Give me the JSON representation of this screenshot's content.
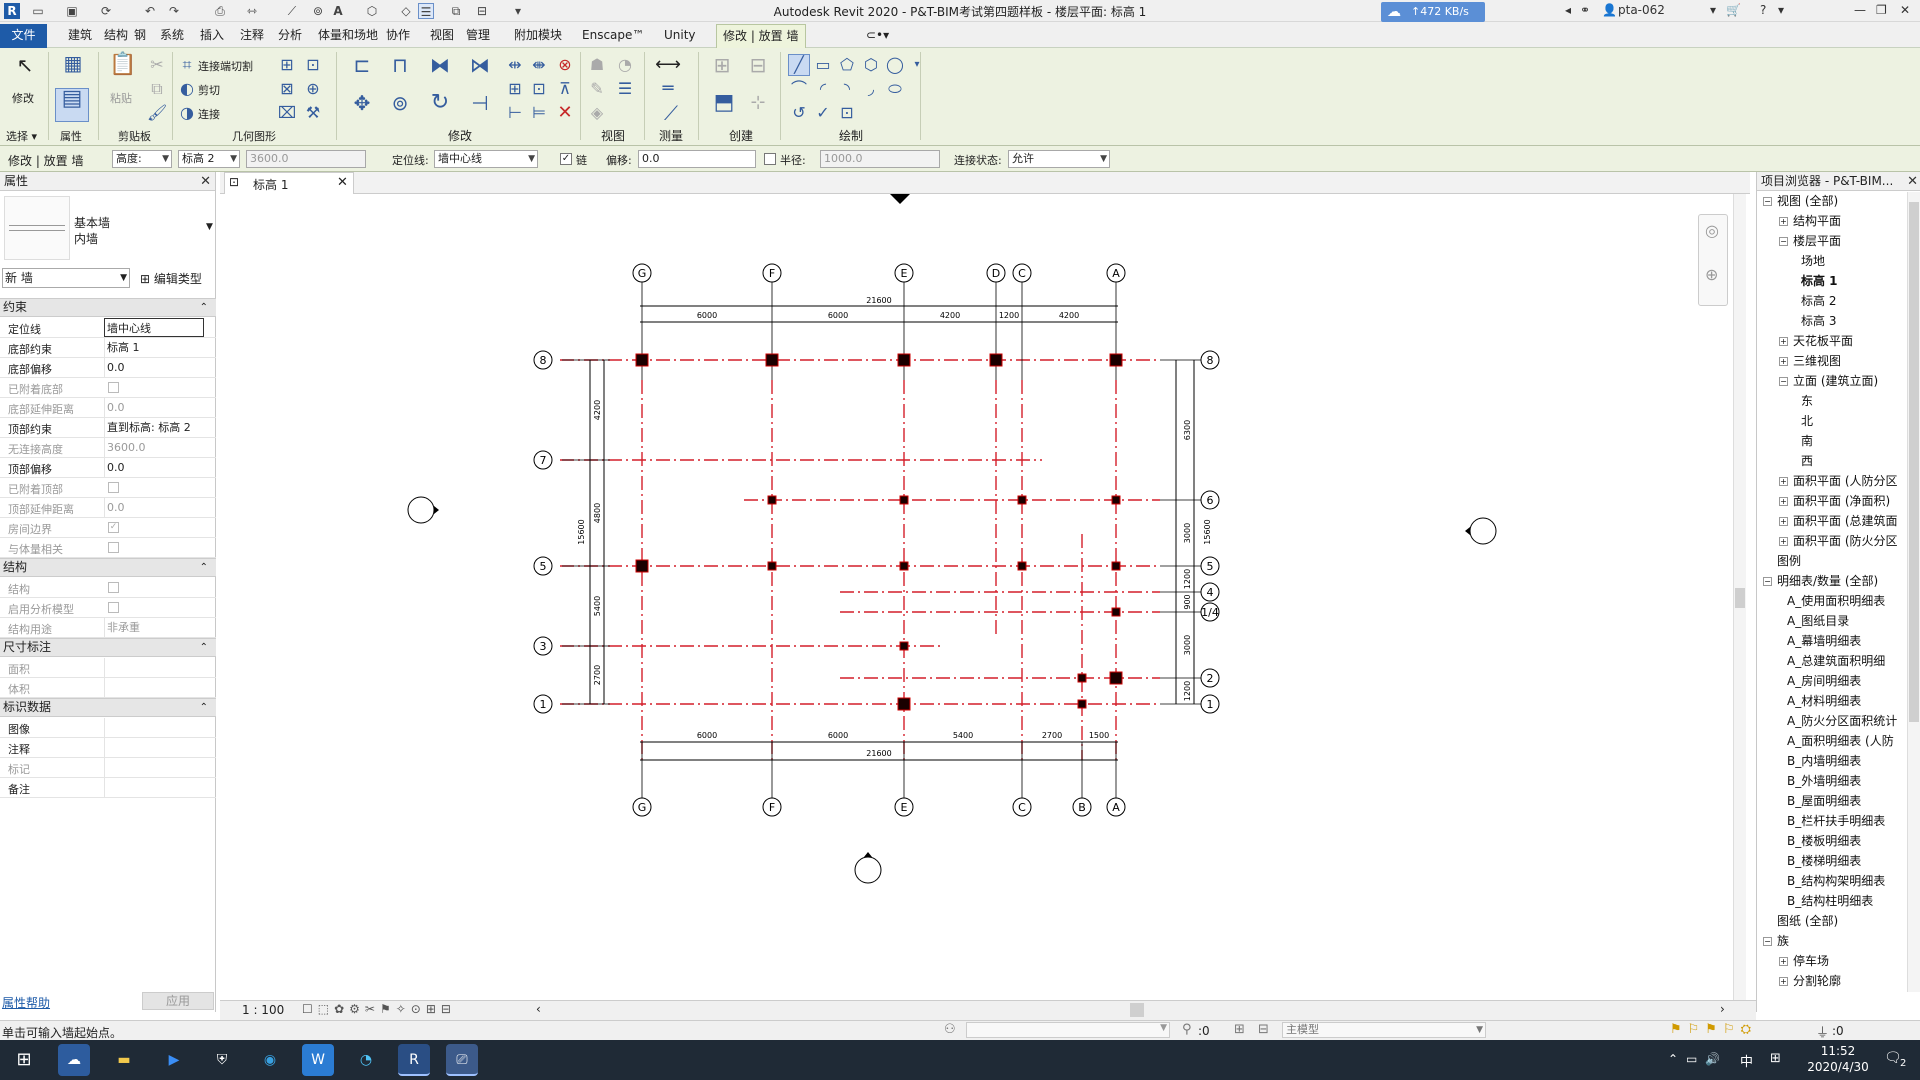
{
  "window": {
    "title": "Autodesk Revit 2020 - P&T-BIM考试第四题样板 - 楼层平面: 标高 1",
    "user": "pta-062",
    "upload_speed": "↑472 KB/s"
  },
  "ribbon_tabs": [
    "文件",
    "建筑",
    "结构",
    "钢",
    "系统",
    "插入",
    "注释",
    "分析",
    "体量和场地",
    "协作",
    "视图",
    "管理",
    "附加模块",
    "Enscape™",
    "Unity",
    "修改 | 放置 墙"
  ],
  "active_tab": "修改 | 放置 墙",
  "ribbon": {
    "select": {
      "modify": "修改",
      "label": "选择 ▾"
    },
    "properties_label": "属性",
    "clipboard": {
      "paste": "粘贴",
      "label": "剪贴板"
    },
    "geometry": {
      "join_cut": "连接端切割",
      "cut": "剪切",
      "join": "连接",
      "label": "几何图形"
    },
    "panels": {
      "modify": "修改",
      "view": "视图",
      "measure": "测量",
      "create": "创建",
      "draw": "绘制"
    }
  },
  "options_bar": {
    "context": "修改 | 放置 墙",
    "height_mode": "高度:",
    "level": "标高 2",
    "height_value": "3600.0",
    "location_line_label": "定位线:",
    "location_line": "墙中心线",
    "chain_label": "链",
    "offset_label": "偏移:",
    "offset_value": "0.0",
    "radius_label": "半径:",
    "radius_value": "1000.0",
    "join_status_label": "连接状态:",
    "join_status": "允许"
  },
  "properties": {
    "title": "属性",
    "type_family": "基本墙",
    "type_name": "内墙",
    "instance_filter": "新 墙",
    "edit_type": "编辑类型",
    "groups": [
      {
        "name": "约束",
        "rows": [
          {
            "k": "定位线",
            "v": "墙中心线",
            "box": true
          },
          {
            "k": "底部约束",
            "v": "标高 1"
          },
          {
            "k": "底部偏移",
            "v": "0.0"
          },
          {
            "k": "已附着底部",
            "cb": true,
            "dis": true
          },
          {
            "k": "底部延伸距离",
            "v": "0.0",
            "dis": true
          },
          {
            "k": "顶部约束",
            "v": "直到标高: 标高 2"
          },
          {
            "k": "无连接高度",
            "v": "3600.0",
            "dis": true
          },
          {
            "k": "顶部偏移",
            "v": "0.0"
          },
          {
            "k": "已附着顶部",
            "cb": true,
            "dis": true
          },
          {
            "k": "顶部延伸距离",
            "v": "0.0",
            "dis": true
          },
          {
            "k": "房间边界",
            "cb": true,
            "checked": true,
            "dis": true
          },
          {
            "k": "与体量相关",
            "cb": true,
            "dis": true
          }
        ]
      },
      {
        "name": "结构",
        "rows": [
          {
            "k": "结构",
            "cb": true,
            "dis": true
          },
          {
            "k": "启用分析模型",
            "cb": true,
            "dis": true
          },
          {
            "k": "结构用途",
            "v": "非承重",
            "dis": true
          }
        ]
      },
      {
        "name": "尺寸标注",
        "rows": [
          {
            "k": "面积",
            "v": "",
            "dis": true
          },
          {
            "k": "体积",
            "v": "",
            "dis": true
          }
        ]
      },
      {
        "name": "标识数据",
        "rows": [
          {
            "k": "图像",
            "v": ""
          },
          {
            "k": "注释",
            "v": ""
          },
          {
            "k": "标记",
            "v": "",
            "dis": true
          },
          {
            "k": "备注",
            "v": ""
          }
        ]
      }
    ],
    "help": "属性帮助",
    "apply": "应用"
  },
  "view_tab": "标高 1",
  "plan": {
    "top_axes": [
      "G",
      "F",
      "E",
      "D",
      "C",
      "A"
    ],
    "bottom_axes": [
      "G",
      "F",
      "E",
      "C",
      "B",
      "A"
    ],
    "left_axes": [
      "8",
      "7",
      "5",
      "3",
      "1"
    ],
    "right_axes": [
      "8",
      "6",
      "5",
      "4",
      "1/4",
      "2",
      "1"
    ],
    "top_dims": [
      "6000",
      "6000",
      "4200",
      "1200",
      "4200"
    ],
    "top_total": "21600",
    "bottom_dims": [
      "6000",
      "6000",
      "5400",
      "2700",
      "1500"
    ],
    "bottom_total": "21600",
    "left_dims": [
      "4200",
      "4800",
      "5400",
      "2700"
    ],
    "left_total": "15600",
    "right_dims": [
      "6300",
      "3000",
      "1200",
      "900",
      "3000",
      "1200"
    ],
    "right_total": "15600"
  },
  "browser": {
    "title": "项目浏览器 - P&T-BIM...",
    "items": [
      {
        "t": "视图 (全部)",
        "lv": 0,
        "ex": "−"
      },
      {
        "t": "结构平面",
        "lv": 1,
        "ex": "+"
      },
      {
        "t": "楼层平面",
        "lv": 1,
        "ex": "−"
      },
      {
        "t": "场地",
        "lv": 2
      },
      {
        "t": "标高 1",
        "lv": 2,
        "bold": true
      },
      {
        "t": "标高 2",
        "lv": 2
      },
      {
        "t": "标高 3",
        "lv": 2
      },
      {
        "t": "天花板平面",
        "lv": 1,
        "ex": "+"
      },
      {
        "t": "三维视图",
        "lv": 1,
        "ex": "+"
      },
      {
        "t": "立面 (建筑立面)",
        "lv": 1,
        "ex": "−"
      },
      {
        "t": "东",
        "lv": 2
      },
      {
        "t": "北",
        "lv": 2
      },
      {
        "t": "南",
        "lv": 2
      },
      {
        "t": "西",
        "lv": 2
      },
      {
        "t": "面积平面 (人防分区",
        "lv": 1,
        "ex": "+"
      },
      {
        "t": "面积平面 (净面积)",
        "lv": 1,
        "ex": "+"
      },
      {
        "t": "面积平面 (总建筑面",
        "lv": 1,
        "ex": "+"
      },
      {
        "t": "面积平面 (防火分区",
        "lv": 1,
        "ex": "+"
      },
      {
        "t": "图例",
        "lv": 0
      },
      {
        "t": "明细表/数量 (全部)",
        "lv": 0,
        "ex": "−"
      },
      {
        "t": "A_使用面积明细表",
        "lv": 1
      },
      {
        "t": "A_图纸目录",
        "lv": 1
      },
      {
        "t": "A_幕墙明细表",
        "lv": 1
      },
      {
        "t": "A_总建筑面积明细",
        "lv": 1
      },
      {
        "t": "A_房间明细表",
        "lv": 1
      },
      {
        "t": "A_材料明细表",
        "lv": 1
      },
      {
        "t": "A_防火分区面积统计",
        "lv": 1
      },
      {
        "t": "A_面积明细表 (人防",
        "lv": 1
      },
      {
        "t": "B_内墙明细表",
        "lv": 1
      },
      {
        "t": "B_外墙明细表",
        "lv": 1
      },
      {
        "t": "B_屋面明细表",
        "lv": 1
      },
      {
        "t": "B_栏杆扶手明细表",
        "lv": 1
      },
      {
        "t": "B_楼板明细表",
        "lv": 1
      },
      {
        "t": "B_楼梯明细表",
        "lv": 1
      },
      {
        "t": "B_结构构架明细表",
        "lv": 1
      },
      {
        "t": "B_结构柱明细表",
        "lv": 1
      },
      {
        "t": "图纸 (全部)",
        "lv": 0
      },
      {
        "t": "族",
        "lv": 0,
        "ex": "−"
      },
      {
        "t": "停车场",
        "lv": 1,
        "ex": "+"
      },
      {
        "t": "分割轮廓",
        "lv": 1,
        "ex": "+"
      }
    ]
  },
  "view_controls": {
    "scale": "1 : 100"
  },
  "status": {
    "hint": "单击可输入墙起始点。",
    "filter_count": ":0",
    "workset": "主模型",
    "select_count": ":0"
  },
  "taskbar": {
    "ime": "中",
    "time": "11:52",
    "date": "2020/4/30",
    "notify": "2"
  }
}
